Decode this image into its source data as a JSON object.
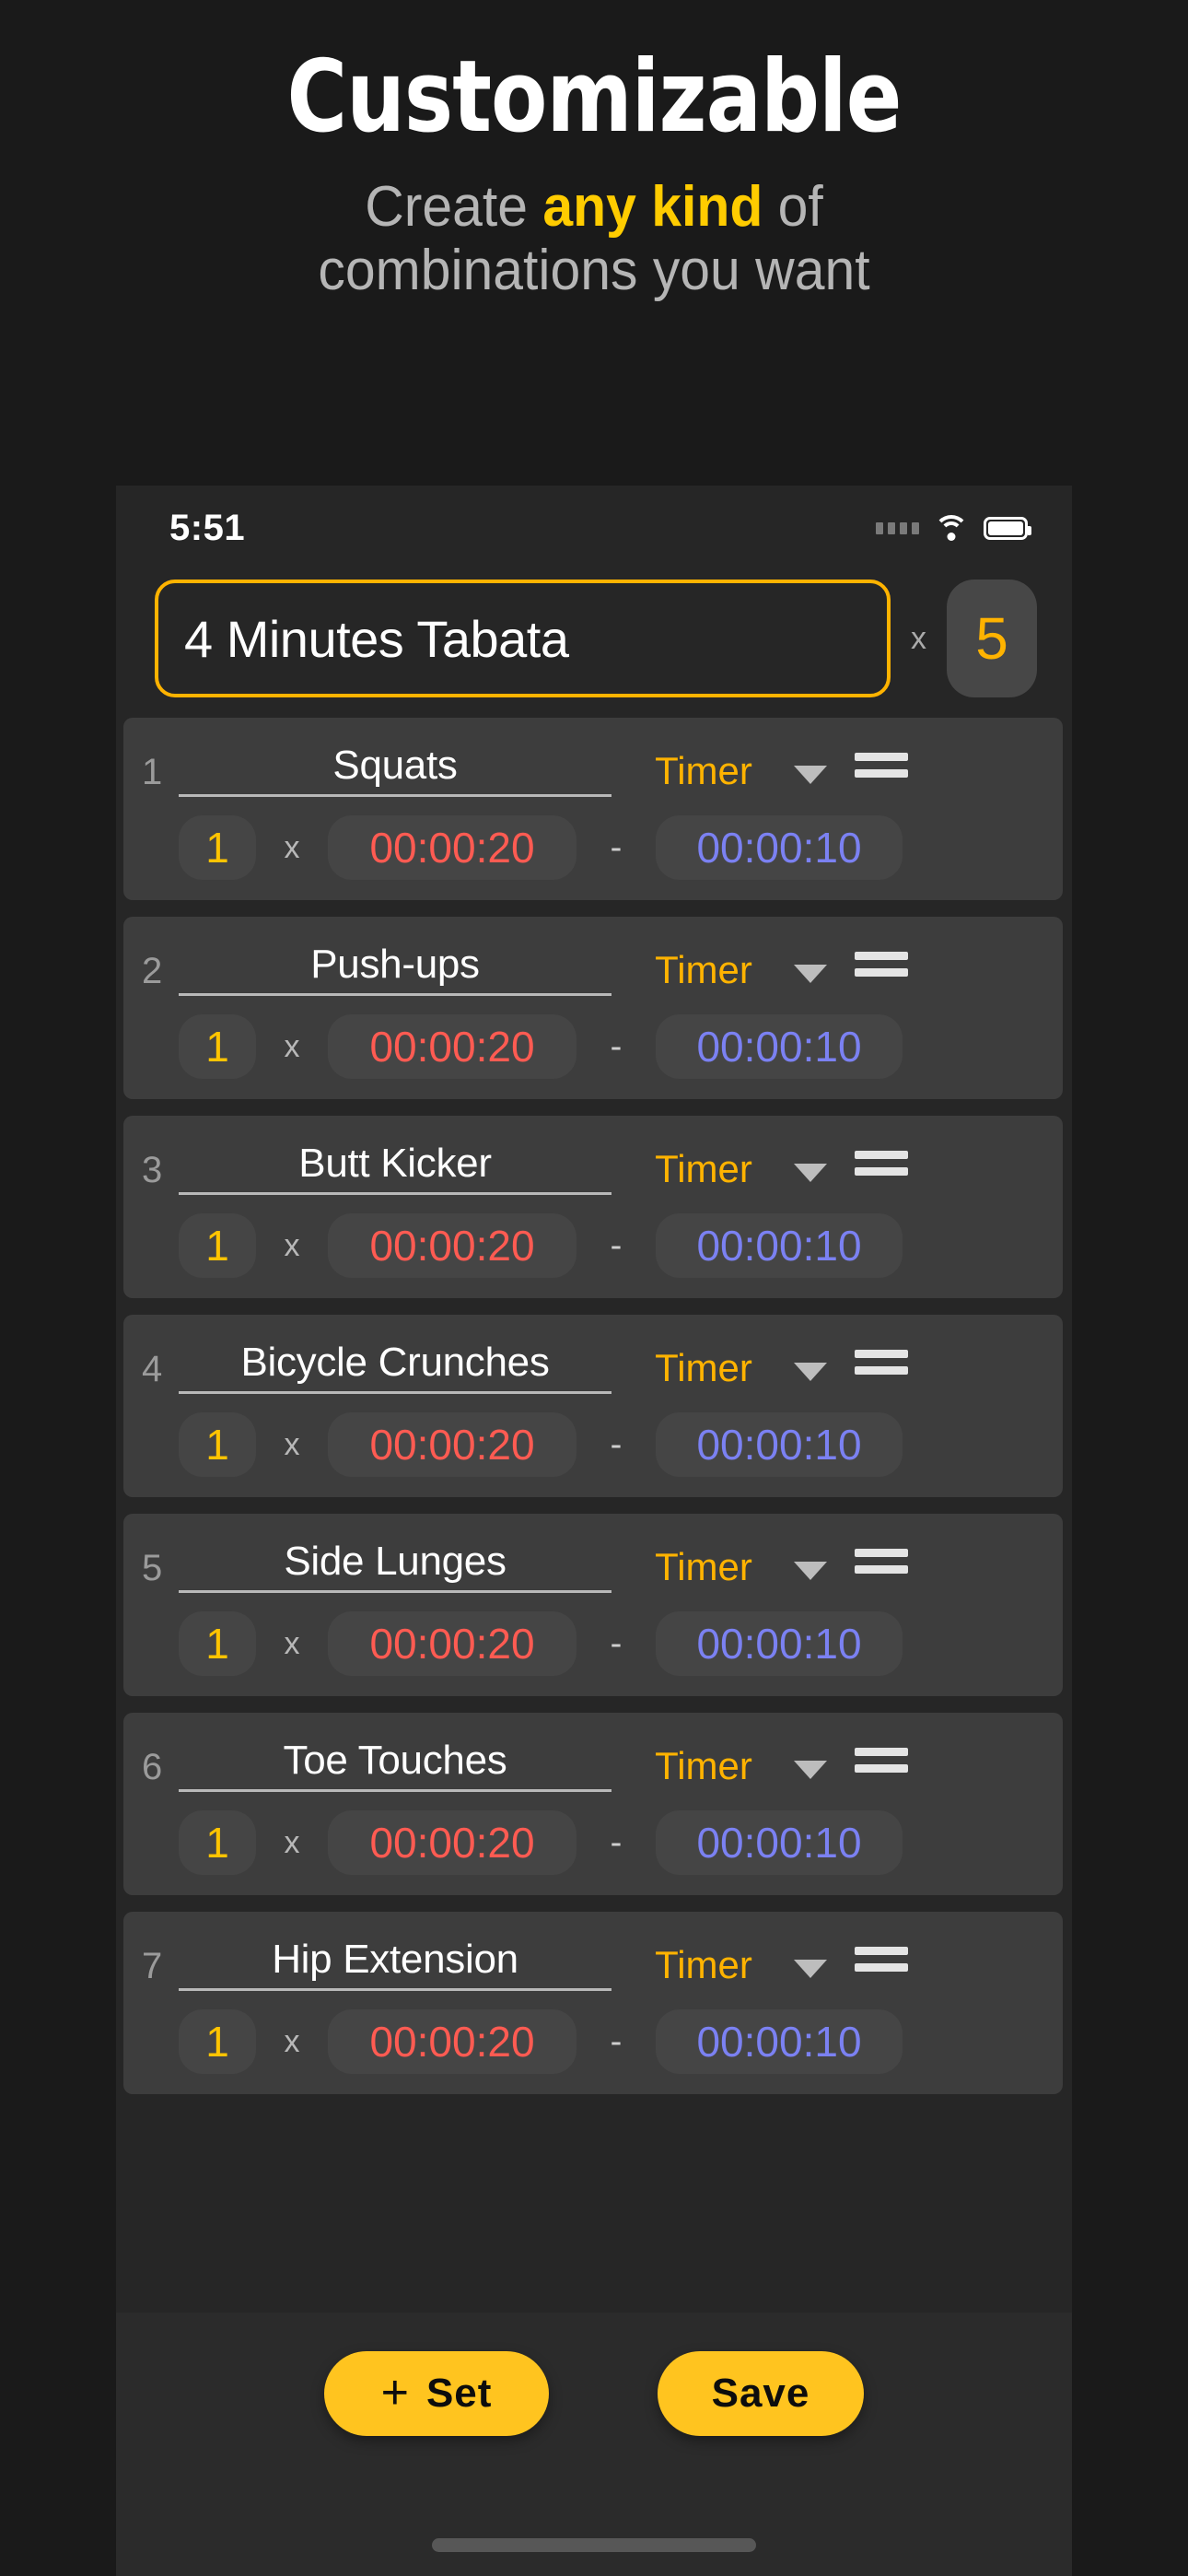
{
  "hero": {
    "title": "Customizable",
    "sub_line1_pre": "Create ",
    "sub_line1_em": "any kind",
    "sub_line1_post": " of",
    "sub_line2": "combinations you want",
    "accent_color": "#FFCC00",
    "muted_color": "#b5b5b5"
  },
  "statusbar": {
    "time": "5:51",
    "signal_icon": "signal-dots-icon",
    "wifi_icon": "wifi-icon",
    "battery_icon": "battery-full-icon"
  },
  "header": {
    "workout_name": "4 Minutes Tabata",
    "workout_name_placeholder": "Workout name",
    "multiply_symbol": "x",
    "rounds": "5"
  },
  "list": {
    "type_label": "Timer",
    "multiply_symbol": "x",
    "range_symbol": "-",
    "exercises": [
      {
        "index": "1",
        "name": "Squats",
        "type": "Timer",
        "reps": "1",
        "work": "00:00:20",
        "rest": "00:00:10"
      },
      {
        "index": "2",
        "name": "Push-ups",
        "type": "Timer",
        "reps": "1",
        "work": "00:00:20",
        "rest": "00:00:10"
      },
      {
        "index": "3",
        "name": "Butt Kicker",
        "type": "Timer",
        "reps": "1",
        "work": "00:00:20",
        "rest": "00:00:10"
      },
      {
        "index": "4",
        "name": "Bicycle Crunches",
        "type": "Timer",
        "reps": "1",
        "work": "00:00:20",
        "rest": "00:00:10"
      },
      {
        "index": "5",
        "name": "Side Lunges",
        "type": "Timer",
        "reps": "1",
        "work": "00:00:20",
        "rest": "00:00:10"
      },
      {
        "index": "6",
        "name": "Toe Touches",
        "type": "Timer",
        "reps": "1",
        "work": "00:00:20",
        "rest": "00:00:10"
      },
      {
        "index": "7",
        "name": "Hip Extension",
        "type": "Timer",
        "reps": "1",
        "work": "00:00:20",
        "rest": "00:00:10"
      }
    ]
  },
  "actions": {
    "add_set_plus": "+",
    "add_set_label": "Set",
    "save_label": "Save"
  },
  "colors": {
    "accent_yellow": "#FFC41F",
    "title_border_yellow": "#FFB300",
    "work_red": "#FF5B52",
    "rest_blue": "#7B81F2",
    "reps_yellow": "#FFC400",
    "page_bg": "#1a1a1a",
    "phone_bg": "#262626",
    "card_bg": "#3d3d3d"
  }
}
